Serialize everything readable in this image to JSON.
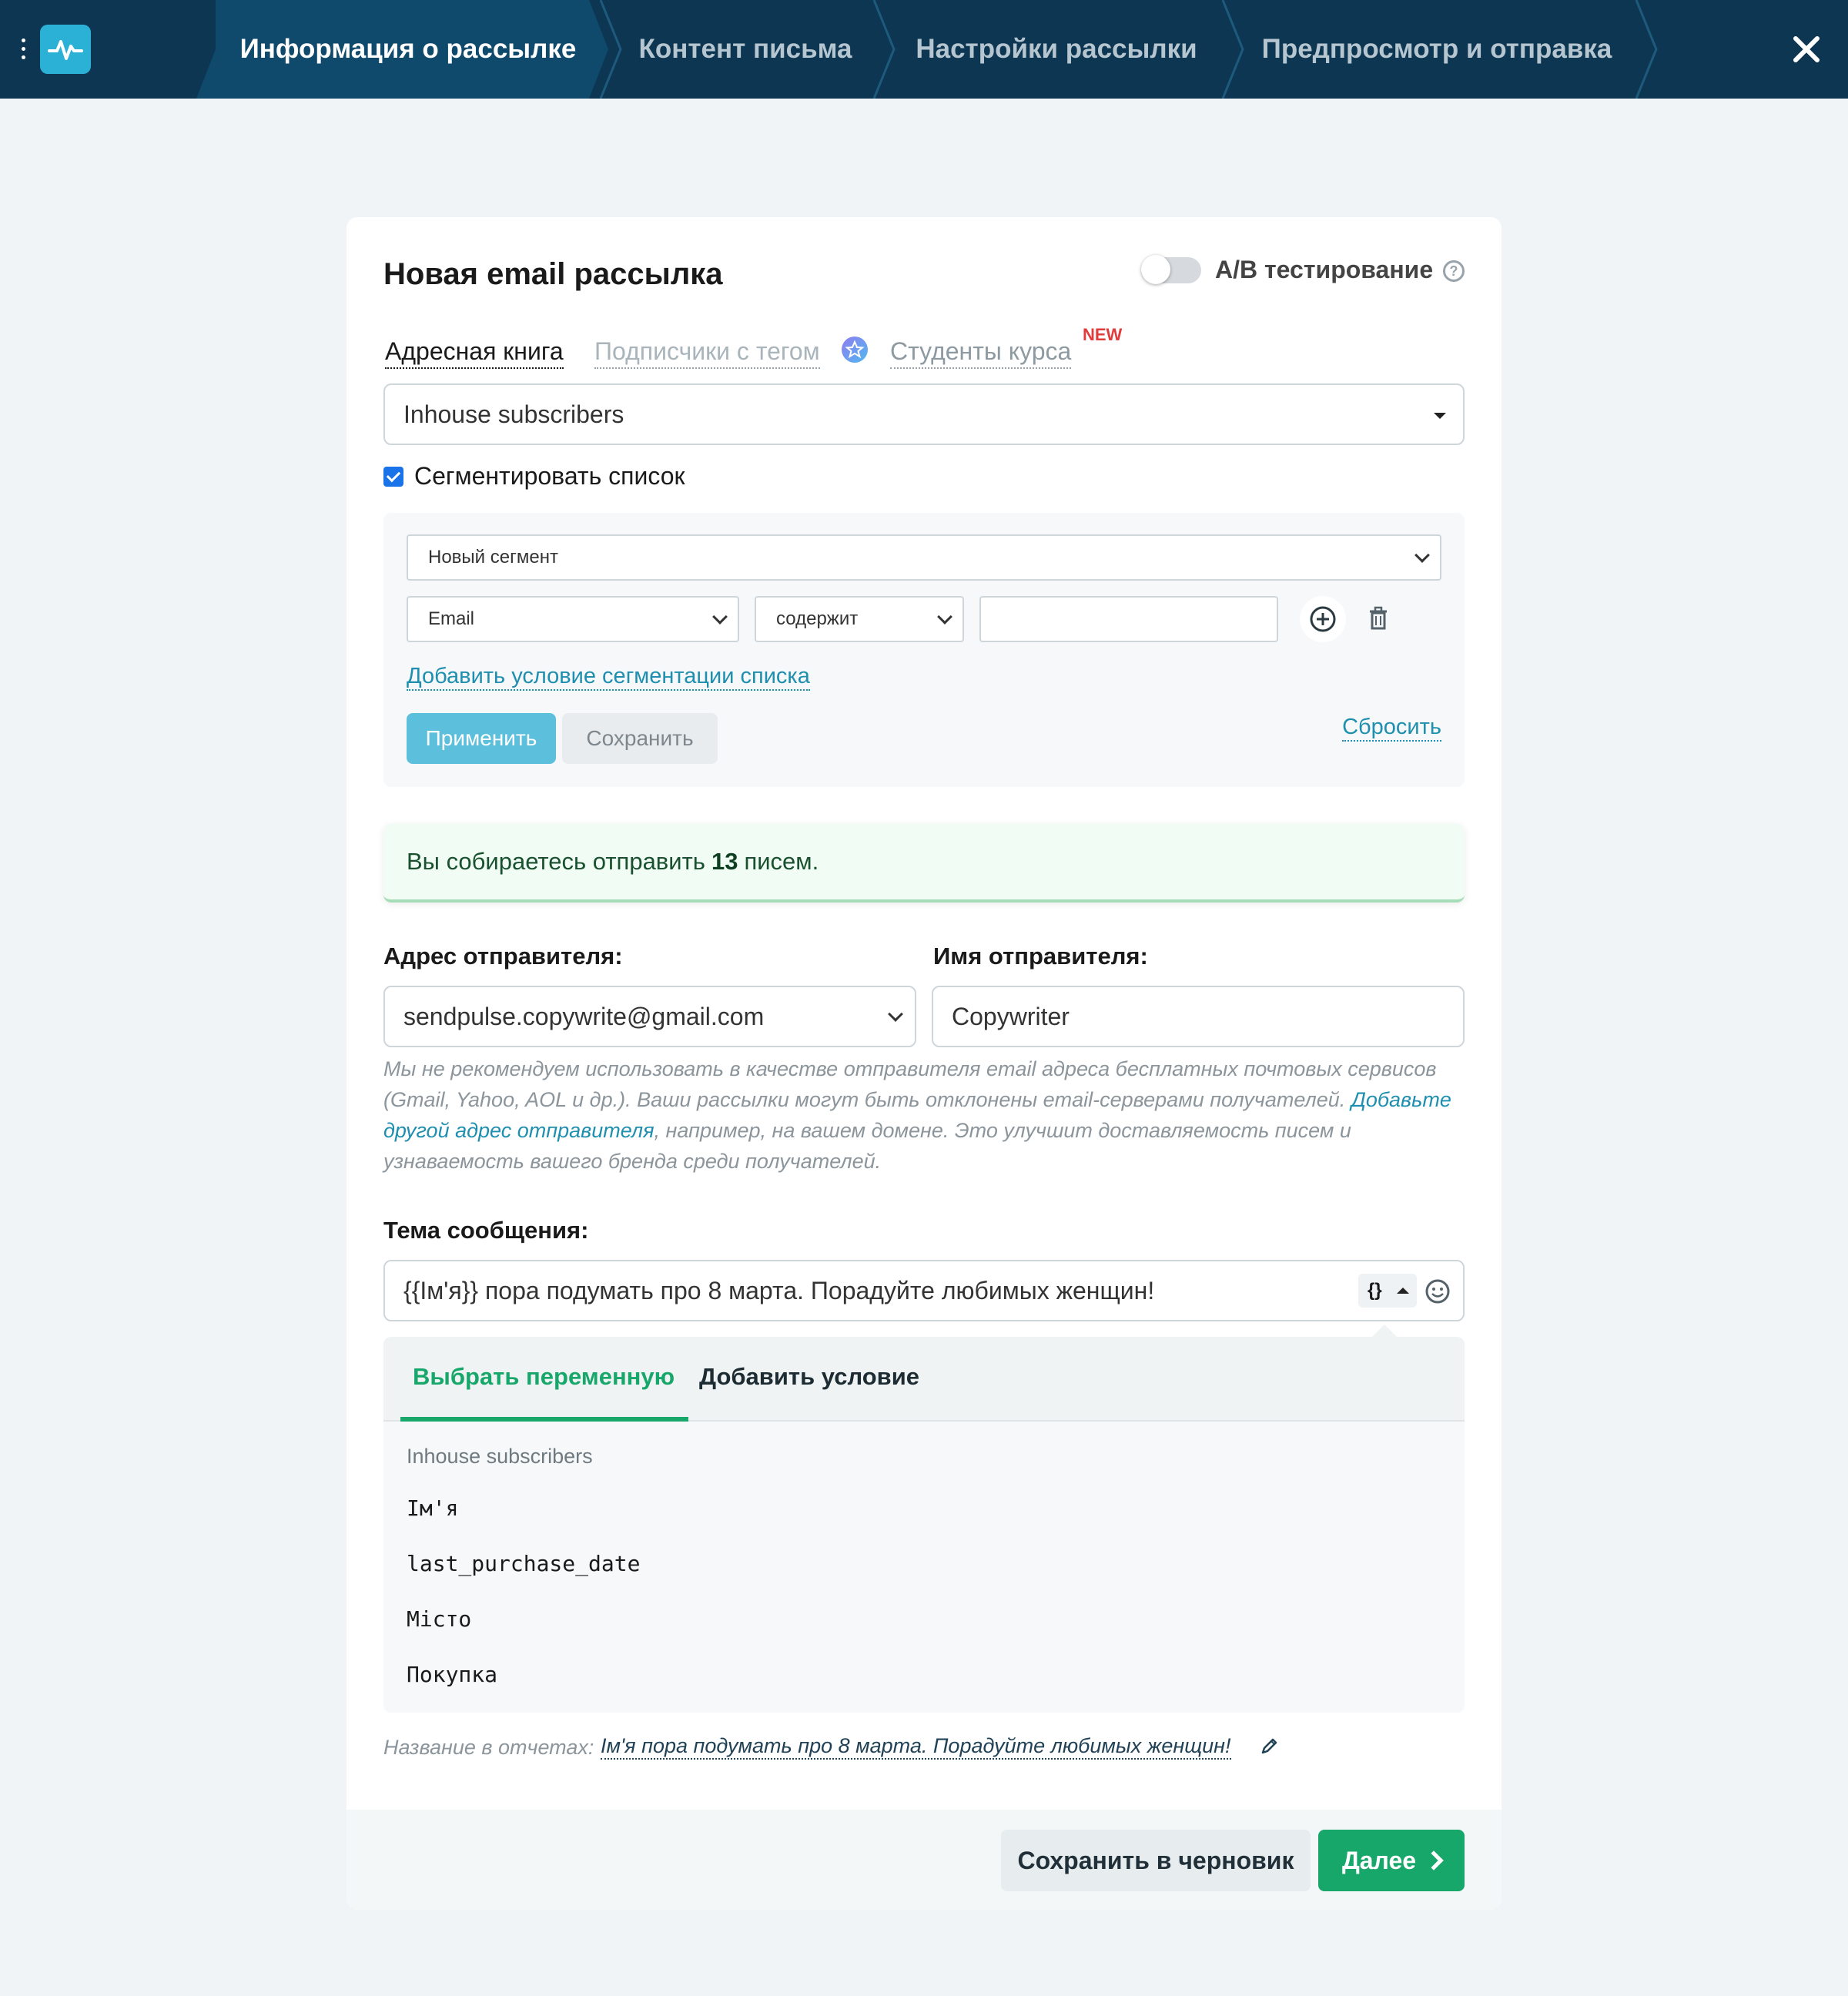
{
  "topbar": {
    "steps": [
      {
        "label": "Информация о рассылке",
        "active": true
      },
      {
        "label": "Контент письма",
        "active": false
      },
      {
        "label": "Настройки рассылки",
        "active": false
      },
      {
        "label": "Предпросмотр и отправка",
        "active": false
      }
    ]
  },
  "card": {
    "title": "Новая email рассылка",
    "ab_label": "A/B тестирование",
    "ab_enabled": false,
    "source_tabs": {
      "address_book": "Адресная книга",
      "tagged": "Подписчики с тегом",
      "students": "Студенты курса",
      "new_badge": "NEW"
    },
    "list_select": "Inhouse subscribers",
    "segment_checkbox_label": "Сегментировать список",
    "segment_checked": true,
    "segment": {
      "segment_select": "Новый сегмент",
      "field_select": "Email",
      "operator_select": "содержит",
      "value_input": "",
      "add_condition_link": "Добавить условие сегментации списка",
      "apply_button": "Применить",
      "save_button": "Сохранить",
      "reset_link": "Сбросить"
    },
    "notice": {
      "prefix": "Вы собираетесь отправить",
      "count": "13",
      "suffix": "писем."
    },
    "sender_address_label": "Адрес отправителя:",
    "sender_address_value": "sendpulse.copywrite@gmail.com",
    "sender_name_label": "Имя отправителя:",
    "sender_name_value": "Copywriter",
    "hint": {
      "part1": "Мы не рекомендуем использовать в качестве отправителя email адреса бесплатных почтовых сервисов (Gmail, Yahoo, AOL и др.). Ваши рассылки могут быть отклонены email-серверами получателей.",
      "link": "Добавьте другой адрес отправителя",
      "part2": ", например, на вашем домене. Это улучшит доставляемость писем и узнаваемость вашего бренда среди получателей."
    },
    "subject_label": "Тема сообщения:",
    "subject_value": "{{Ім'я}} пора подумать про 8 марта. Порадуйте любимых женщин!",
    "variable_button": "{}",
    "panel": {
      "tab_variable": "Выбрать переменную",
      "tab_condition": "Добавить условие",
      "group_title": "Inhouse subscribers",
      "variables": [
        "Ім'я",
        "last_purchase_date",
        "Місто",
        "Покупка"
      ]
    },
    "report_label": "Название в отчетах:",
    "report_value": "Ім'я пора подумать про 8 марта. Порадуйте любимых женщин!",
    "draft_button": "Сохранить в черновик",
    "next_button": "Далее"
  },
  "colors": {
    "topbar": "#0d3652",
    "active_step": "#0f4a6d",
    "accent_green": "#17a76a",
    "accent_blue": "#5cc0dc",
    "link": "#1f8fb0"
  }
}
